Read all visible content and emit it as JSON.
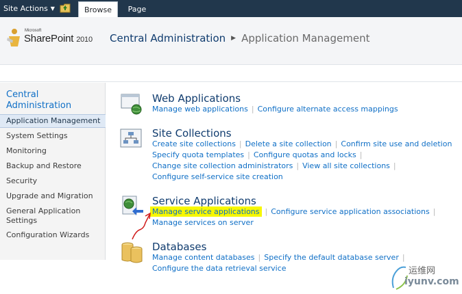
{
  "ribbon": {
    "site_actions": "Site Actions",
    "tabs": [
      {
        "label": "Browse",
        "selected": true
      },
      {
        "label": "Page",
        "selected": false
      }
    ]
  },
  "header": {
    "logo_small": "Microsoft",
    "logo_main": "SharePoint",
    "logo_year": "2010",
    "breadcrumb": [
      "Central Administration",
      "Application Management"
    ]
  },
  "leftnav": {
    "heading": "Central Administration",
    "items": [
      {
        "label": "Application Management",
        "selected": true
      },
      {
        "label": "System Settings"
      },
      {
        "label": "Monitoring"
      },
      {
        "label": "Backup and Restore"
      },
      {
        "label": "Security"
      },
      {
        "label": "Upgrade and Migration"
      },
      {
        "label": "General Application Settings"
      },
      {
        "label": "Configuration Wizards"
      }
    ]
  },
  "sections": {
    "web_apps": {
      "title": "Web Applications",
      "links": [
        "Manage web applications",
        "Configure alternate access mappings"
      ]
    },
    "site_collections": {
      "title": "Site Collections",
      "links": [
        "Create site collections",
        "Delete a site collection",
        "Confirm site use and deletion",
        "Specify quota templates",
        "Configure quotas and locks",
        "Change site collection administrators",
        "View all site collections",
        "Configure self-service site creation"
      ]
    },
    "service_apps": {
      "title": "Service Applications",
      "links": [
        "Manage service applications",
        "Configure service application associations",
        "Manage services on server"
      ]
    },
    "databases": {
      "title": "Databases",
      "links": [
        "Manage content databases",
        "Specify the default database server",
        "Configure the data retrieval service"
      ]
    }
  },
  "watermark": {
    "line1": "运维网",
    "line2": "iyunv.com"
  },
  "colors": {
    "ribbon": "#21374c",
    "link": "#0f6fc6",
    "title": "#0f3b6e",
    "highlight": "#f7f700",
    "annotation_arrow": "#d01a1a"
  }
}
